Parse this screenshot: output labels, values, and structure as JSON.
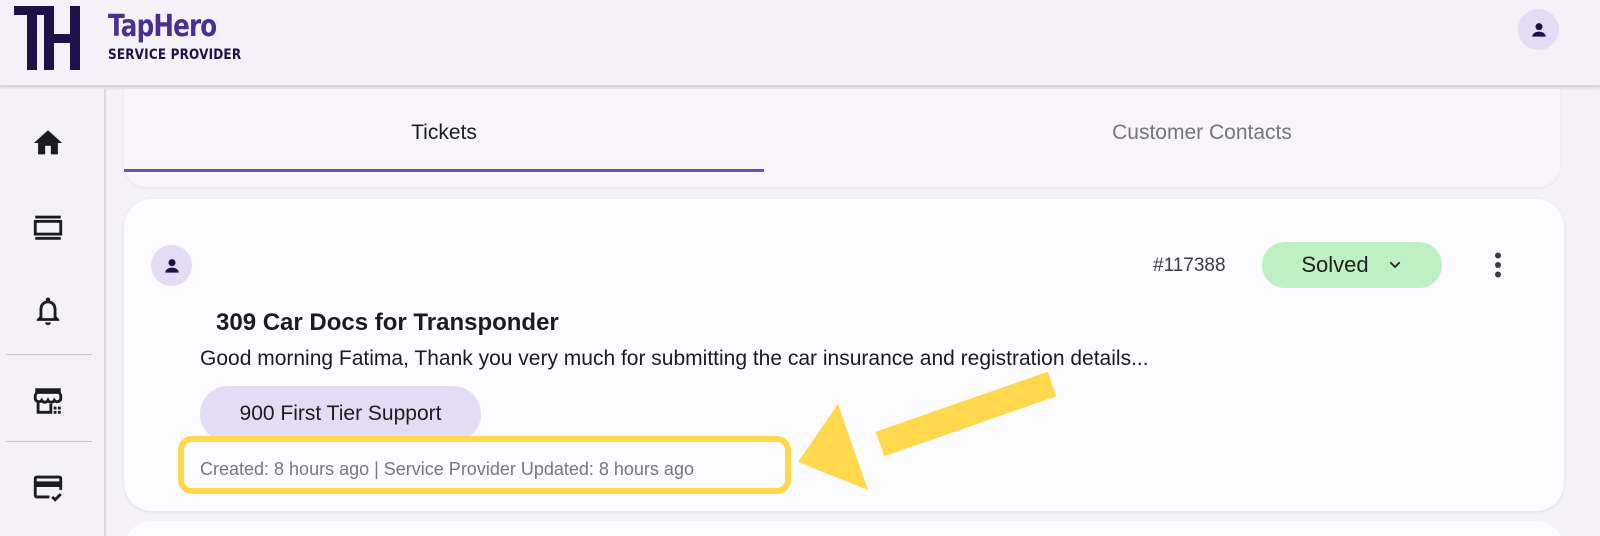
{
  "brand": {
    "logo_mark": "TH",
    "name": "TapHero",
    "subtitle": "SERVICE PROVIDER",
    "color": "#4a2f8f"
  },
  "header": {
    "account_icon": "account-icon"
  },
  "sidebar": {
    "items": [
      {
        "icon": "home-icon"
      },
      {
        "icon": "tickets-list-icon"
      },
      {
        "icon": "notifications-bell-icon"
      },
      {
        "icon": "storefront-icon"
      },
      {
        "icon": "credit-card-check-icon"
      }
    ]
  },
  "tabs": [
    {
      "label": "Tickets",
      "active": true
    },
    {
      "label": "Customer Contacts",
      "active": false
    }
  ],
  "ticket": {
    "number": "#117388",
    "status": "Solved",
    "status_color": "#bff0c3",
    "title": "309 Car Docs for Transponder",
    "excerpt": "Good morning Fatima,  Thank you very much for submitting the car insurance and registration details...",
    "group": "900 First Tier Support",
    "meta": "Created: 8 hours ago | Service Provider Updated: 8 hours ago"
  },
  "annotation": {
    "color": "#ffd84d"
  }
}
